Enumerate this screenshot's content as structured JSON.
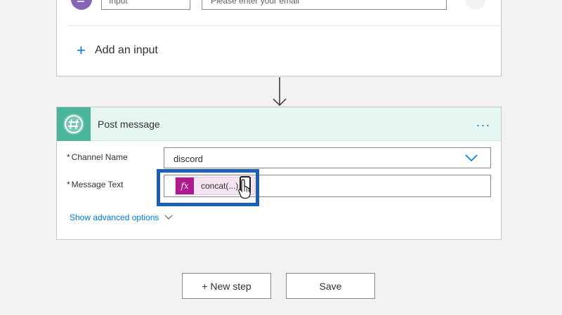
{
  "trigger": {
    "input_type": "Input",
    "input_description": "Please enter your email",
    "add_input_label": "Add an input"
  },
  "action": {
    "title": "Post message",
    "menu_label": "...",
    "channel": {
      "required_mark": "*",
      "label": "Channel Name",
      "value": "discord"
    },
    "message": {
      "required_mark": "*",
      "label": "Message Text",
      "token_icon": "fx",
      "token_text": "concat(...)"
    },
    "advanced_label": "Show advanced options"
  },
  "buttons": {
    "new_step": "+ New step",
    "save": "Save"
  },
  "colors": {
    "accent": "#0078d4",
    "slack_green": "#4ab59a",
    "expression_magenta": "#ad1a8e",
    "highlight_blue": "#1a5fb4"
  },
  "icons": {
    "trigger": "text-input-icon",
    "action": "slack-hash-icon",
    "token": "expression-fx-icon",
    "dropdown": "chevron-down-icon",
    "connector": "arrow-down-icon"
  }
}
